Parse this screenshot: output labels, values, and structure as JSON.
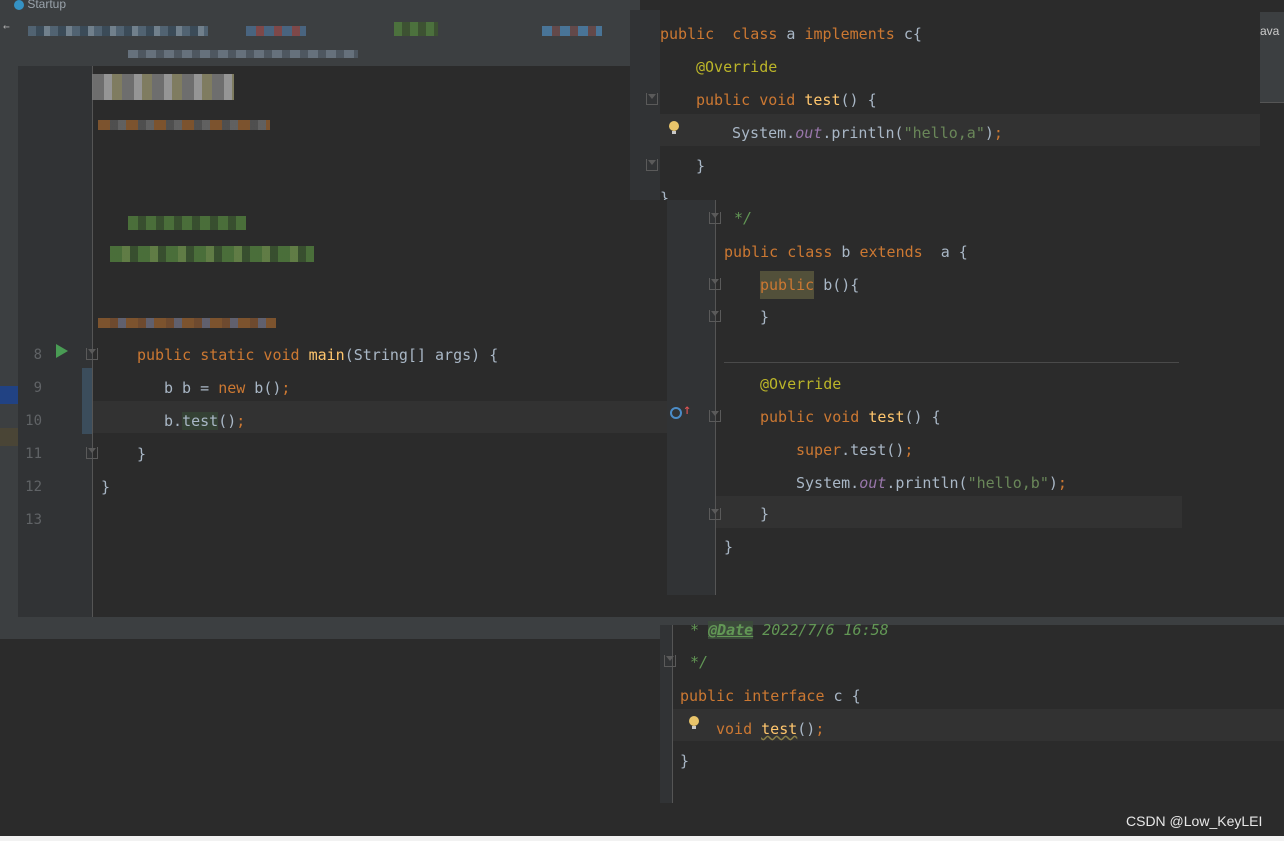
{
  "tab": {
    "title": "Startup"
  },
  "top_right_fragment": "ava",
  "main_editor": {
    "line_numbers": [
      "8",
      "9",
      "10",
      "11",
      "12",
      "13"
    ],
    "lines": [
      {
        "kw1": "public static void",
        "name": "main",
        "rest": "(String[] args) {"
      },
      {
        "pre": "b b = ",
        "kw": "new",
        "post": " b()",
        "semi": ";"
      },
      {
        "obj": "b.",
        "call": "test",
        "post": "()",
        "semi": ";"
      },
      {
        "text": "}"
      },
      {
        "text": "}"
      }
    ]
  },
  "class_a": {
    "line1": {
      "kw1": "public",
      "kw2": "class",
      "name": " a ",
      "kw3": "implements",
      "rest": " c{"
    },
    "annotation": "@Override",
    "method": {
      "kw": "public void",
      "name": "test",
      "rest": "() {"
    },
    "body": {
      "obj": "System.",
      "field": "out",
      "call": ".println(",
      "str": "\"hello,a\"",
      "end": ")",
      "semi": ";"
    },
    "close": "}",
    "close2": "}"
  },
  "class_b": {
    "comment_end": "*/",
    "line1": {
      "kw1": "public class",
      "name": " b ",
      "kw2": "extends",
      "rest": "  a {"
    },
    "ctor": {
      "kw": "public",
      "rest": " b(){"
    },
    "ctor_close": "}",
    "annotation": "@Override",
    "method": {
      "kw": "public void",
      "name": "test",
      "rest": "() {"
    },
    "super_line": {
      "kw": "super",
      "rest": ".test()",
      "semi": ";"
    },
    "body": {
      "obj": "System.",
      "field": "out",
      "call": ".println(",
      "str": "\"hello,b\"",
      "end": ")",
      "semi": ";"
    },
    "method_close": "}",
    "class_close": "}"
  },
  "interface_c": {
    "date_prefix": "* ",
    "date_tag": "@Date",
    "date_value": " 2022/7/6 16:58",
    "comment_end": "*/",
    "line1": {
      "kw": "public interface",
      "rest": " c {"
    },
    "method": {
      "kw": "void",
      "name": "test",
      "rest": "()",
      "semi": ";"
    },
    "close": "}"
  },
  "watermark": "CSDN @Low_KeyLEI",
  "colors": {
    "keyword": "#cc7832",
    "function": "#ffc66d",
    "annotation": "#bbb529",
    "string": "#6a8759",
    "static_field": "#9876aa",
    "comment": "#629755",
    "background": "#2b2b2b",
    "gutter": "#313335",
    "run_icon": "#499c54"
  }
}
